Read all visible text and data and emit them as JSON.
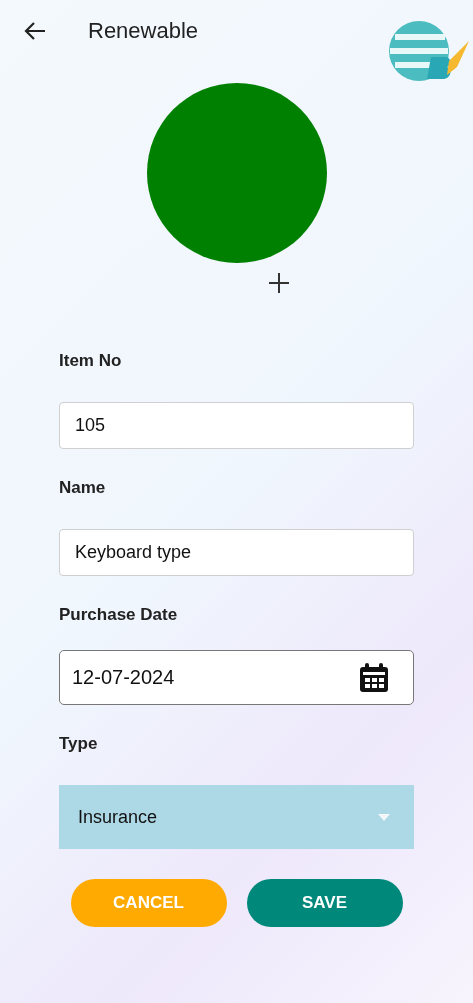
{
  "header": {
    "title": "Renewable"
  },
  "fields": [
    {
      "kind": "text",
      "label": "Item No",
      "value": "105"
    },
    {
      "kind": "text",
      "label": "Name",
      "value": "Keyboard type"
    },
    {
      "kind": "date",
      "label": "Purchase Date",
      "value": "12-07-2024"
    },
    {
      "kind": "dropdown",
      "label": "Type",
      "value": "Insurance"
    }
  ],
  "buttons": [
    {
      "kind": "cancel",
      "label": "CANCEL"
    },
    {
      "kind": "save",
      "label": "SAVE"
    }
  ]
}
